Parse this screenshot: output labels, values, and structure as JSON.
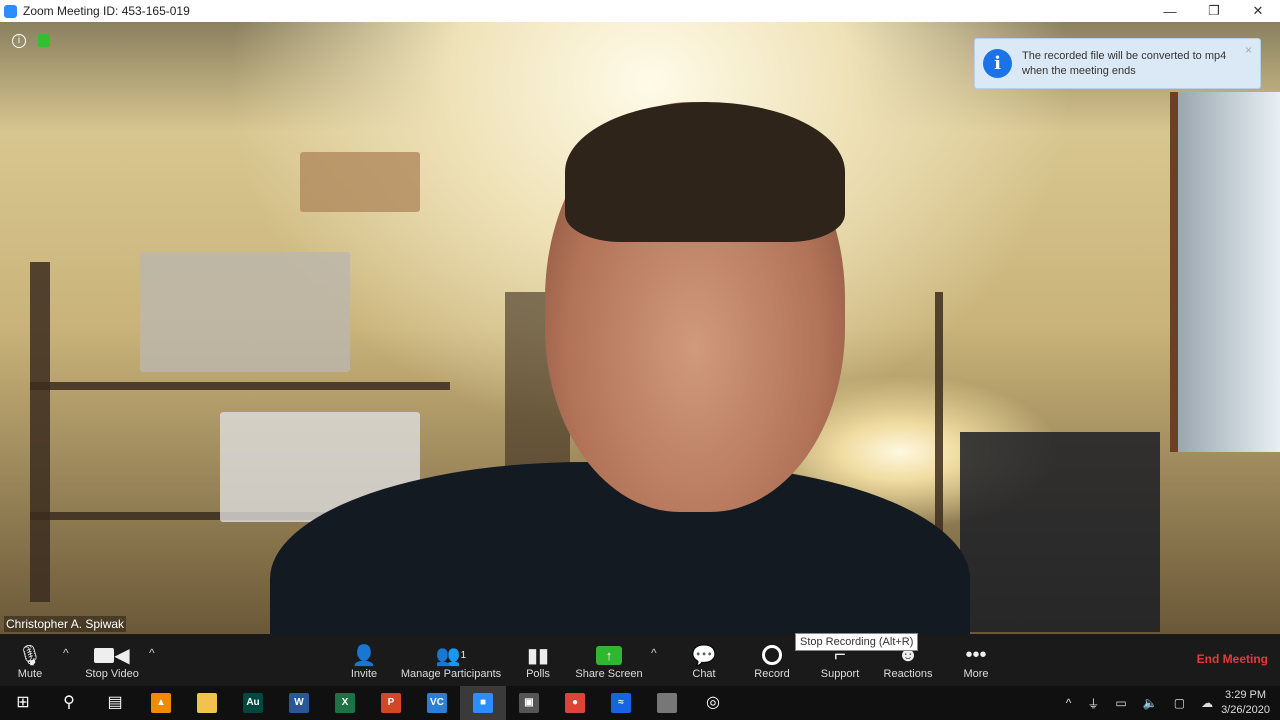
{
  "window": {
    "title": "Zoom Meeting ID: 453-165-019",
    "minimize": "—",
    "restore": "❐",
    "close": "✕"
  },
  "video": {
    "participant_name": "Christopher A. Spiwak",
    "info_icon": "i"
  },
  "toast": {
    "icon": "i",
    "message": "The recorded file will be converted to mp4 when the meeting ends",
    "close": "×"
  },
  "toolbar": {
    "mute": "Mute",
    "stop_video": "Stop Video",
    "invite": "Invite",
    "manage_participants": "Manage Participants",
    "participant_count": "1",
    "polls": "Polls",
    "share_screen": "Share Screen",
    "chat": "Chat",
    "record": "Record",
    "support": "Support",
    "reactions": "Reactions",
    "more": "More",
    "end_meeting": "End Meeting",
    "tooltip": "Stop Recording (Alt+R)",
    "caret": "^"
  },
  "taskbar": {
    "apps": [
      {
        "name": "start",
        "glyph": "⊞",
        "color": "transparent"
      },
      {
        "name": "search",
        "glyph": "⚲",
        "color": "transparent"
      },
      {
        "name": "task-view",
        "glyph": "▤",
        "color": "transparent"
      },
      {
        "name": "vlc",
        "glyph": "▲",
        "color": "#f08a00"
      },
      {
        "name": "file-explorer",
        "glyph": "",
        "color": "#f2c14e"
      },
      {
        "name": "audition",
        "glyph": "Au",
        "color": "#00473f"
      },
      {
        "name": "word",
        "glyph": "W",
        "color": "#2b5797"
      },
      {
        "name": "excel",
        "glyph": "X",
        "color": "#1e7145"
      },
      {
        "name": "powerpoint",
        "glyph": "P",
        "color": "#d24726"
      },
      {
        "name": "visual-studio-code",
        "glyph": "VC",
        "color": "#2a7fd4"
      },
      {
        "name": "zoom",
        "glyph": "■",
        "color": "#2d8cff"
      },
      {
        "name": "projector",
        "glyph": "▣",
        "color": "#555"
      },
      {
        "name": "chrome",
        "glyph": "●",
        "color": "#db4437"
      },
      {
        "name": "app-waves",
        "glyph": "≈",
        "color": "#1565e0"
      },
      {
        "name": "mouse",
        "glyph": "",
        "color": "#777"
      },
      {
        "name": "obs",
        "glyph": "◎",
        "color": "transparent"
      }
    ],
    "tray": {
      "chevron": "^",
      "usb": "⏚",
      "battery": "▭",
      "volume": "🔈",
      "network": "▢",
      "cloud": "☁"
    },
    "time": "3:29 PM",
    "date": "3/26/2020"
  }
}
